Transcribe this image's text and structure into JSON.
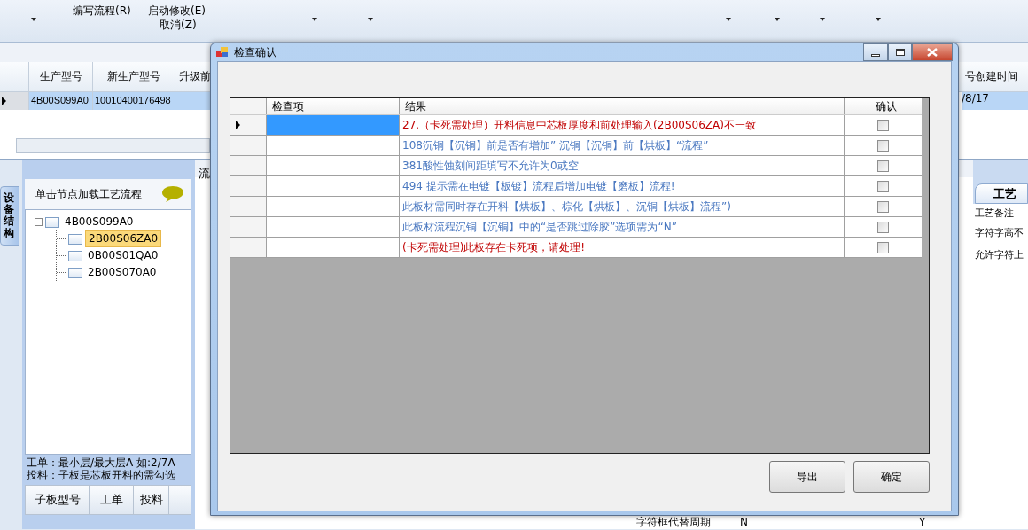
{
  "toolbar": {
    "menu_items": [
      "编写流程(R)",
      "启动修改(E)",
      "取消(Z)"
    ]
  },
  "main_grid": {
    "columns": [
      "生产型号",
      "新生产型号",
      "升级前",
      "号创建时间"
    ],
    "rows": [
      {
        "selected": true,
        "model": "4B00S099A0",
        "new_model": "10010400176498",
        "created_time": "/8/17"
      }
    ]
  },
  "left_panel": {
    "vertical_tab": "设备结构",
    "header": "单击节点加载工艺流程",
    "tree": [
      {
        "label": "4B00S099A0",
        "expanded": true,
        "selected": false,
        "children": [
          {
            "label": "2B00S06ZA0",
            "selected": true
          },
          {
            "label": "0B00S01QA0",
            "selected": false
          },
          {
            "label": "2B00S070A0",
            "selected": false
          }
        ]
      }
    ],
    "notes": [
      "工单：最小层/最大层A 如:2/7A",
      "投料：子板是芯板开料的需勾选"
    ],
    "table_columns": [
      "子板型号",
      "工单",
      "投料"
    ]
  },
  "middle_panel": {
    "header": "流",
    "bottom_row": [
      "字符框代替周期",
      "N",
      "Y"
    ]
  },
  "right_panel": {
    "tab": "工艺",
    "header": "工艺备注",
    "rows": [
      "字符字高不",
      "允许字符上"
    ]
  },
  "dialog": {
    "title": "检查确认",
    "columns": [
      "检查项",
      "结果",
      "确认"
    ],
    "rows": [
      {
        "selected": true,
        "result": "27.（卡死需处理）开料信息中芯板厚度和前处理输入(2B00S06ZA)不一致",
        "color": "#c00000",
        "checked": false
      },
      {
        "selected": false,
        "result": "108沉铜【沉铜】前是否有增加”  沉铜【沉铜】前【烘板】“流程”",
        "color": "#4a78c0",
        "checked": false
      },
      {
        "selected": false,
        "result": "381酸性蚀刻间距填写不允许为0或空",
        "color": "#4a78c0",
        "checked": false
      },
      {
        "selected": false,
        "result": "494 提示需在电镀【板镀】流程后增加电镀【磨板】流程!",
        "color": "#4a78c0",
        "checked": false
      },
      {
        "selected": false,
        "result": "此板材需同时存在开料【烘板】、棕化【烘板】、沉铜【烘板】流程”)",
        "color": "#4a78c0",
        "checked": false
      },
      {
        "selected": false,
        "result": "此板材流程沉铜【沉铜】中的“是否跳过除胶”选项需为“N”",
        "color": "#4a78c0",
        "checked": false
      },
      {
        "selected": false,
        "result": "(卡死需处理)此板存在卡死项，请处理!",
        "color": "#c00000",
        "checked": false
      }
    ],
    "buttons": [
      "导出",
      "确定"
    ]
  }
}
